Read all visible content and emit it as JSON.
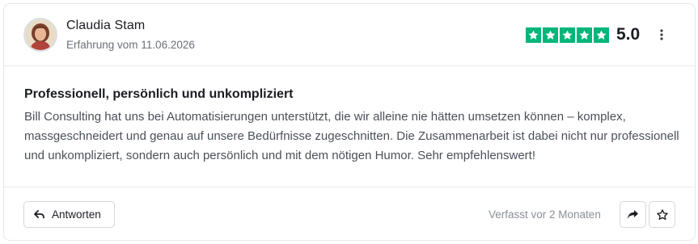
{
  "review": {
    "author": {
      "name": "Claudia Stam",
      "experience": "Erfahrung vom 11.06.2026",
      "avatar_icon": "avatar-photo"
    },
    "rating": {
      "value_label": "5.0",
      "stars": 5,
      "max_stars": 5,
      "star_color": "#00b67a"
    },
    "title": "Professionell, persönlich und unkompliziert",
    "text": "Bill Consulting hat uns bei Automatisierungen unterstützt, die wir alleine nie hätten umsetzen können – komplex, massgeschneidert und genau auf unsere Bedürfnisse zugeschnitten. Die Zusammenarbeit ist dabei nicht nur professionell und unkompliziert, sondern auch persönlich und mit dem nötigen Humor. Sehr empfehlenswert!",
    "footer": {
      "reply_label": "Antworten",
      "reply_icon": "reply-arrow-icon",
      "written_ago": "Verfasst vor 2 Monaten",
      "share_icon": "share-arrow-icon",
      "save_icon": "star-outline-icon",
      "more_icon": "vertical-dots-icon"
    }
  }
}
